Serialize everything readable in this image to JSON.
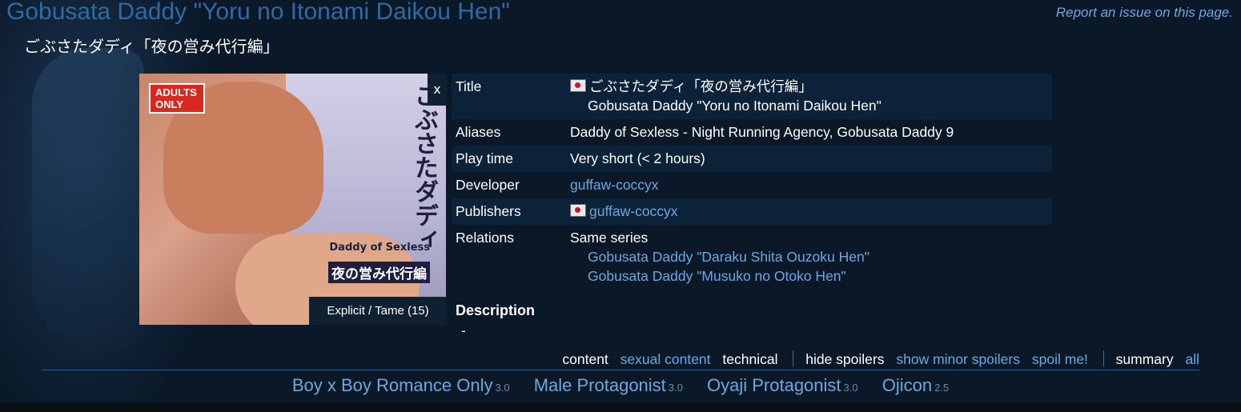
{
  "header": {
    "title": "Gobusata Daddy \"Yoru no Itonami Daikou Hen\"",
    "original_title": "ごぶさたダディ「夜の営み代行編」",
    "report_link": "Report an issue on this page."
  },
  "cover": {
    "badge": "ADULTS ONLY",
    "jp_title": "ごぶさたダディ",
    "en_sub": "Daddy of Sexless",
    "jp_sub": "夜の営み代行編",
    "close": "x",
    "rating": "Explicit / Tame (15)"
  },
  "info": {
    "title_label": "Title",
    "title_jp": "ごぶさたダディ「夜の営み代行編」",
    "title_romaji": "Gobusata Daddy \"Yoru no Itonami Daikou Hen\"",
    "aliases_label": "Aliases",
    "aliases": "Daddy of Sexless - Night Running Agency, Gobusata Daddy 9",
    "playtime_label": "Play time",
    "playtime": "Very short (< 2 hours)",
    "developer_label": "Developer",
    "developer": "guffaw-coccyx",
    "publishers_label": "Publishers",
    "publisher": "guffaw-coccyx",
    "relations_label": "Relations",
    "relation_type": "Same series",
    "relations": [
      "Gobusata Daddy \"Daraku Shita Ouzoku Hen\"",
      "Gobusata Daddy \"Musuko no Otoko Hen\""
    ]
  },
  "description": {
    "heading": "Description",
    "text": "-"
  },
  "filters": {
    "content": "content",
    "sexual": "sexual content",
    "technical": "technical",
    "hide_spoilers": "hide spoilers",
    "minor_spoilers": "show minor spoilers",
    "spoil_me": "spoil me!",
    "summary": "summary",
    "all": "all"
  },
  "tags": [
    {
      "name": "Boy x Boy Romance Only",
      "score": "3.0"
    },
    {
      "name": "Male Protagonist",
      "score": "3.0"
    },
    {
      "name": "Oyaji Protagonist",
      "score": "3.0"
    },
    {
      "name": "Ojicon",
      "score": "2.5"
    }
  ],
  "colors": {
    "background": "#0a1828",
    "title": "#2f6aa3",
    "link": "#6ea8e0",
    "row_alt": "#0c2238"
  }
}
